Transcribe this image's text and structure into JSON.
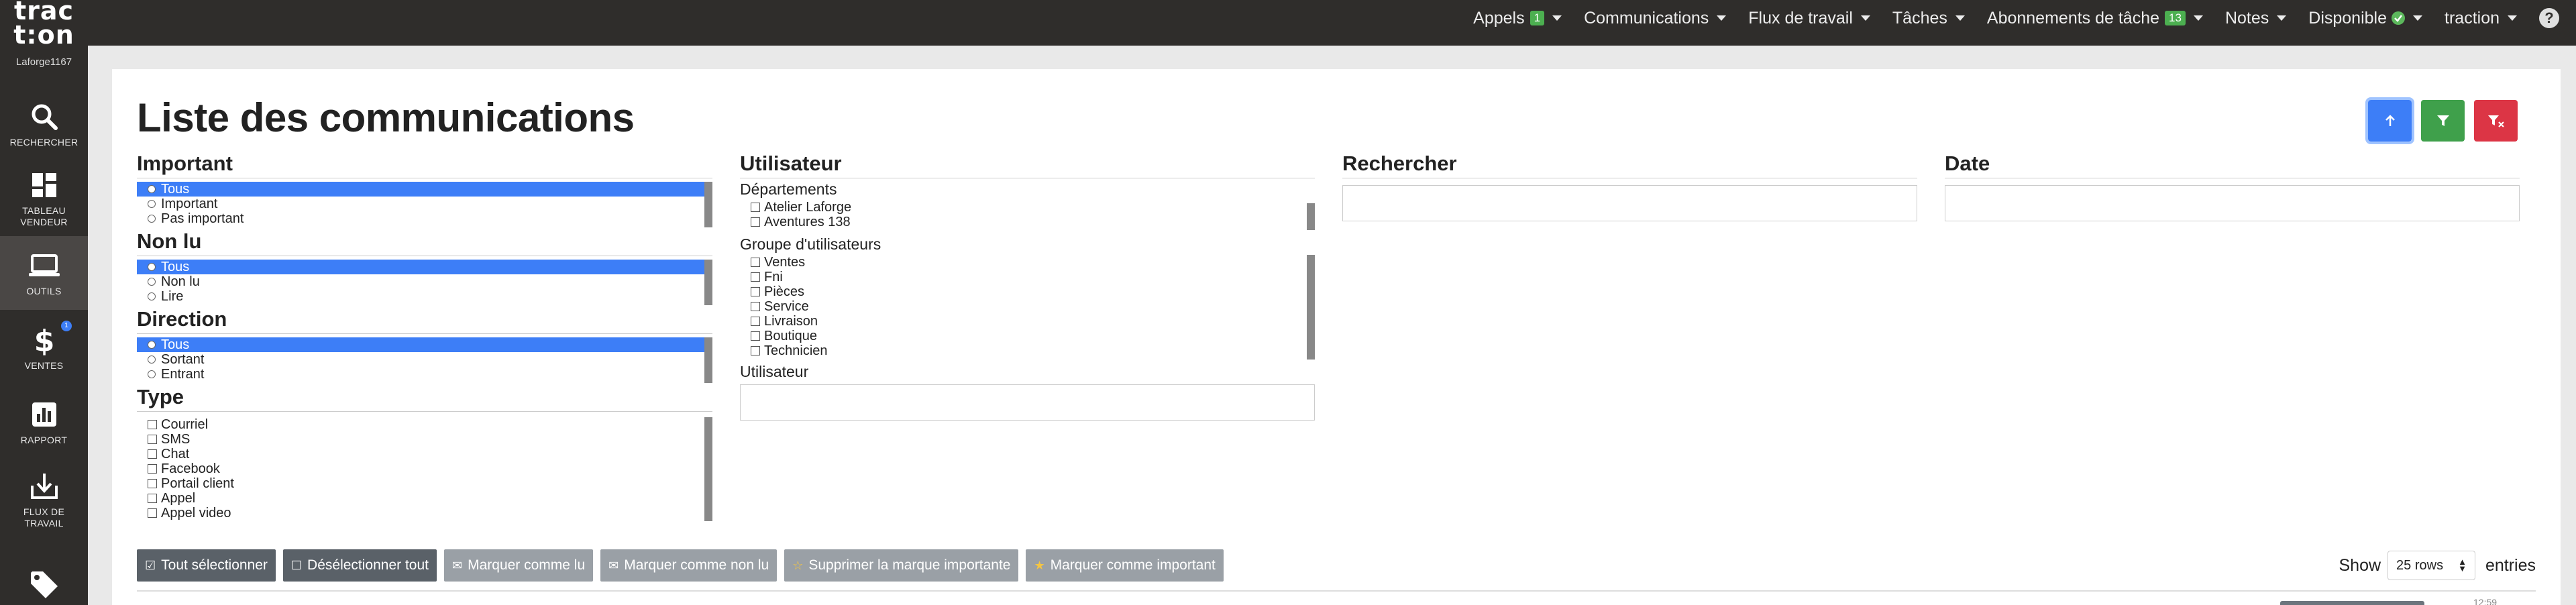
{
  "app": {
    "logo_line1": "trac",
    "logo_line2": "t:on",
    "account": "Laforge1167"
  },
  "sidebar": {
    "items": [
      {
        "label": "RECHERCHER",
        "icon": "search-icon"
      },
      {
        "label": "TABLEAU VENDEUR",
        "icon": "dashboard-icon"
      },
      {
        "label": "OUTILS",
        "icon": "laptop-icon",
        "active": true
      },
      {
        "label": "VENTES",
        "icon": "dollar-icon",
        "badge": "1"
      },
      {
        "label": "RAPPORT",
        "icon": "report-icon"
      },
      {
        "label": "FLUX DE TRAVAIL",
        "icon": "download-icon"
      },
      {
        "label": "",
        "icon": "tag-icon"
      }
    ]
  },
  "topnav": {
    "items": [
      {
        "label": "Appels",
        "badge": "1"
      },
      {
        "label": "Communications"
      },
      {
        "label": "Flux de travail"
      },
      {
        "label": "Tâches"
      },
      {
        "label": "Abonnements de tâche",
        "badge": "13"
      },
      {
        "label": "Notes"
      },
      {
        "label": "Disponible"
      },
      {
        "label": "traction"
      }
    ],
    "help": "?"
  },
  "page": {
    "title": "Liste des communications"
  },
  "filters": {
    "important": {
      "title": "Important",
      "options": [
        "Tous",
        "Important",
        "Pas important"
      ],
      "selected": "Tous"
    },
    "non_lu": {
      "title": "Non lu",
      "options": [
        "Tous",
        "Non lu",
        "Lire"
      ],
      "selected": "Tous"
    },
    "direction": {
      "title": "Direction",
      "options": [
        "Tous",
        "Sortant",
        "Entrant"
      ],
      "selected": "Tous"
    },
    "type": {
      "title": "Type",
      "options": [
        "Courriel",
        "SMS",
        "Chat",
        "Facebook",
        "Portail client",
        "Appel",
        "Appel video"
      ]
    },
    "utilisateur": {
      "title": "Utilisateur",
      "departements_label": "Départements",
      "departements": [
        "Atelier Laforge",
        "Aventures 138"
      ],
      "groupes_label": "Groupe d'utilisateurs",
      "groupes": [
        "Ventes",
        "Fni",
        "Pièces",
        "Service",
        "Livraison",
        "Boutique",
        "Technicien"
      ],
      "user_label": "Utilisateur"
    },
    "rechercher": {
      "title": "Rechercher",
      "value": ""
    },
    "date": {
      "title": "Date",
      "value": ""
    }
  },
  "actions": {
    "select_all": "Tout sélectionner",
    "deselect_all": "Désélectionner tout",
    "mark_read": "Marquer comme lu",
    "mark_unread": "Marquer comme non lu",
    "remove_important": "Supprimer la marque importante",
    "mark_important": "Marquer comme important"
  },
  "table": {
    "show_label": "Show",
    "rows_value": "25 rows",
    "entries_label": "entries",
    "peek_time": "12:59"
  },
  "colors": {
    "accent": "#3d7ef7",
    "success": "#3fa04b",
    "danger": "#dc3545",
    "sidebar": "#2f2d2b"
  }
}
